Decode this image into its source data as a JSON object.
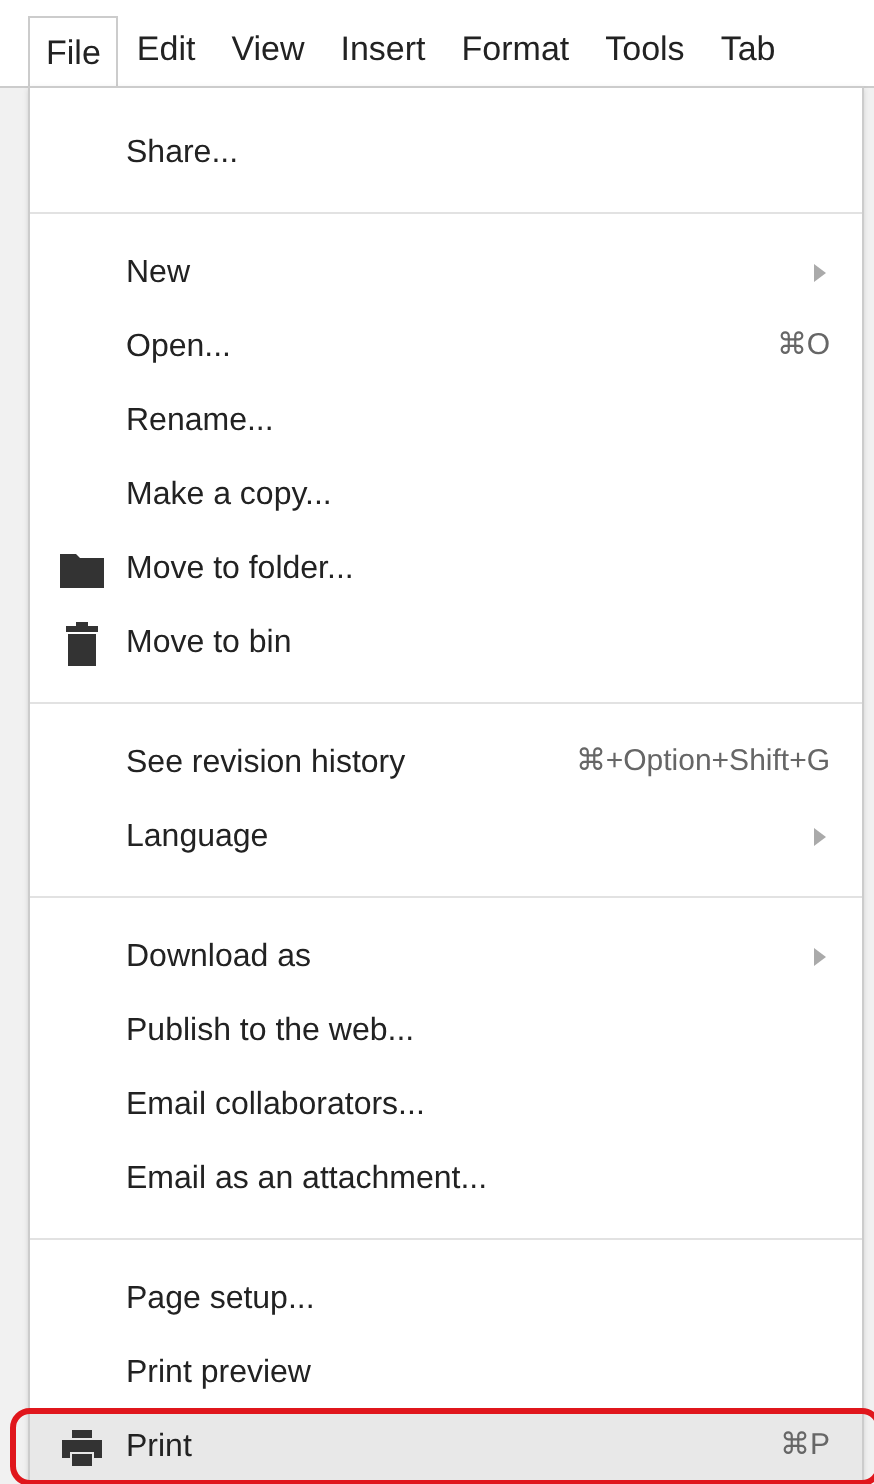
{
  "menubar": [
    {
      "label": "File",
      "selected": true
    },
    {
      "label": "Edit",
      "selected": false
    },
    {
      "label": "View",
      "selected": false
    },
    {
      "label": "Insert",
      "selected": false
    },
    {
      "label": "Format",
      "selected": false
    },
    {
      "label": "Tools",
      "selected": false
    },
    {
      "label": "Tab",
      "selected": false
    }
  ],
  "menu": {
    "groups": [
      {
        "items": [
          {
            "kind": "text",
            "label": "Share...",
            "submenu": false,
            "selected": false,
            "circled": false
          }
        ]
      },
      {
        "items": [
          {
            "kind": "text",
            "label": "New",
            "submenu": true,
            "selected": false,
            "circled": false
          },
          {
            "kind": "text",
            "label": "Open...",
            "shortcut": "⌘O",
            "submenu": false,
            "selected": false,
            "circled": false
          },
          {
            "kind": "text",
            "label": "Rename...",
            "submenu": false,
            "selected": false,
            "circled": false
          },
          {
            "kind": "text",
            "label": "Make a copy...",
            "submenu": false,
            "selected": false,
            "circled": false
          },
          {
            "kind": "folder",
            "label": "Move to folder...",
            "submenu": false,
            "selected": false,
            "circled": false
          },
          {
            "kind": "trash",
            "label": "Move to bin",
            "submenu": false,
            "selected": false,
            "circled": false
          }
        ]
      },
      {
        "items": [
          {
            "kind": "text",
            "label": "See revision history",
            "shortcut": "⌘+Option+Shift+G",
            "submenu": false,
            "selected": false,
            "circled": false
          },
          {
            "kind": "text",
            "label": "Language",
            "submenu": true,
            "selected": false,
            "circled": false
          }
        ]
      },
      {
        "items": [
          {
            "kind": "text",
            "label": "Download as",
            "submenu": true,
            "selected": false,
            "circled": false
          },
          {
            "kind": "text",
            "label": "Publish to the web...",
            "submenu": false,
            "selected": false,
            "circled": false
          },
          {
            "kind": "text",
            "label": "Email collaborators...",
            "submenu": false,
            "selected": false,
            "circled": false
          },
          {
            "kind": "text",
            "label": "Email as an attachment...",
            "submenu": false,
            "selected": false,
            "circled": false
          }
        ]
      },
      {
        "items": [
          {
            "kind": "text",
            "label": "Page setup...",
            "submenu": false,
            "selected": false,
            "circled": false
          },
          {
            "kind": "text",
            "label": "Print preview",
            "submenu": false,
            "selected": false,
            "circled": false
          },
          {
            "kind": "printer",
            "label": "Print",
            "shortcut": "⌘P",
            "submenu": false,
            "selected": true,
            "circled": true
          }
        ]
      }
    ]
  }
}
